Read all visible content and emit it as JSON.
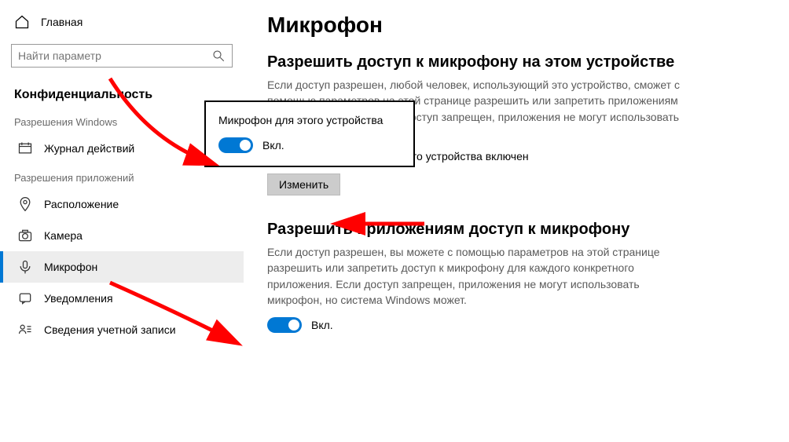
{
  "sidebar": {
    "home": "Главная",
    "search_placeholder": "Найти параметр",
    "section": "Конфиденциальность",
    "group_windows": "Разрешения Windows",
    "group_apps": "Разрешения приложений",
    "items": {
      "activity": "Журнал действий",
      "location": "Расположение",
      "camera": "Камера",
      "microphone": "Микрофон",
      "notifications": "Уведомления",
      "account": "Сведения учетной записи"
    }
  },
  "main": {
    "title": "Микрофон",
    "section1_title": "Разрешить доступ к микрофону на этом устройстве",
    "section1_desc": "Если доступ разрешен, любой человек, использующий это устройство, сможет с помощью параметров на этой странице разрешить или запретить приложениям доступ к микрофону. Если доступ запрещен, приложения не могут использовать микрофон.",
    "status": "Доступ к микрофону для этого устройства включен",
    "change_btn": "Изменить",
    "section2_title": "Разрешить приложениям доступ к микрофону",
    "section2_desc": "Если доступ разрешен, вы можете с помощью параметров на этой странице разрешить или запретить доступ к микрофону для каждого конкретного приложения. Если доступ запрещен, приложения не могут использовать микрофон, но система Windows может.",
    "toggle_on": "Вкл."
  },
  "popup": {
    "title": "Микрофон для этого устройства",
    "toggle_on": "Вкл."
  }
}
